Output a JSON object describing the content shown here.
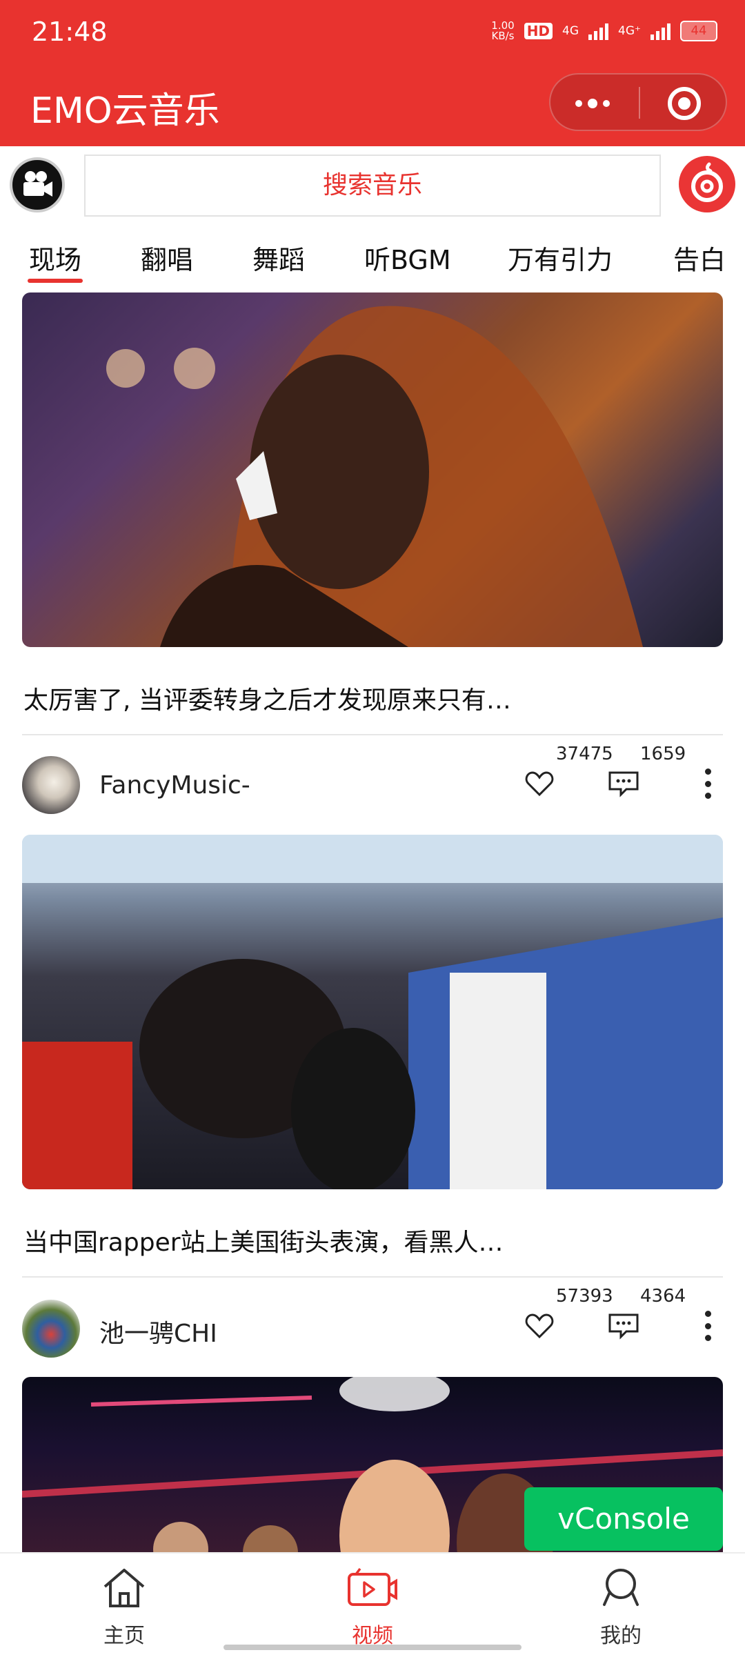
{
  "status_bar": {
    "time": "21:48",
    "net_speed": "1.00\nKB/s",
    "hd": "HD",
    "sim1": "4G",
    "sim2": "4G⁺",
    "battery": "44"
  },
  "header": {
    "title": "EMO云音乐"
  },
  "search": {
    "placeholder": "搜索音乐"
  },
  "tabs": [
    "现场",
    "翻唱",
    "舞蹈",
    "听BGM",
    "万有引力",
    "告白"
  ],
  "feed": [
    {
      "title": "太厉害了, 当评委转身之后才发现原来只有…"
    },
    {
      "author": "FancyMusic-",
      "likes": "37475",
      "comments": "1659",
      "title": "当中国rapper站上美国街头表演，看黑人…"
    },
    {
      "author": "池一骋CHI",
      "likes": "57393",
      "comments": "4364"
    }
  ],
  "vconsole": {
    "label": "vConsole"
  },
  "bottom_nav": [
    {
      "label": "主页",
      "icon": "home-icon"
    },
    {
      "label": "视频",
      "icon": "video-icon",
      "active": true
    },
    {
      "label": "我的",
      "icon": "user-icon"
    }
  ],
  "colors": {
    "accent": "#e8332f",
    "vconsole": "#07c160"
  }
}
